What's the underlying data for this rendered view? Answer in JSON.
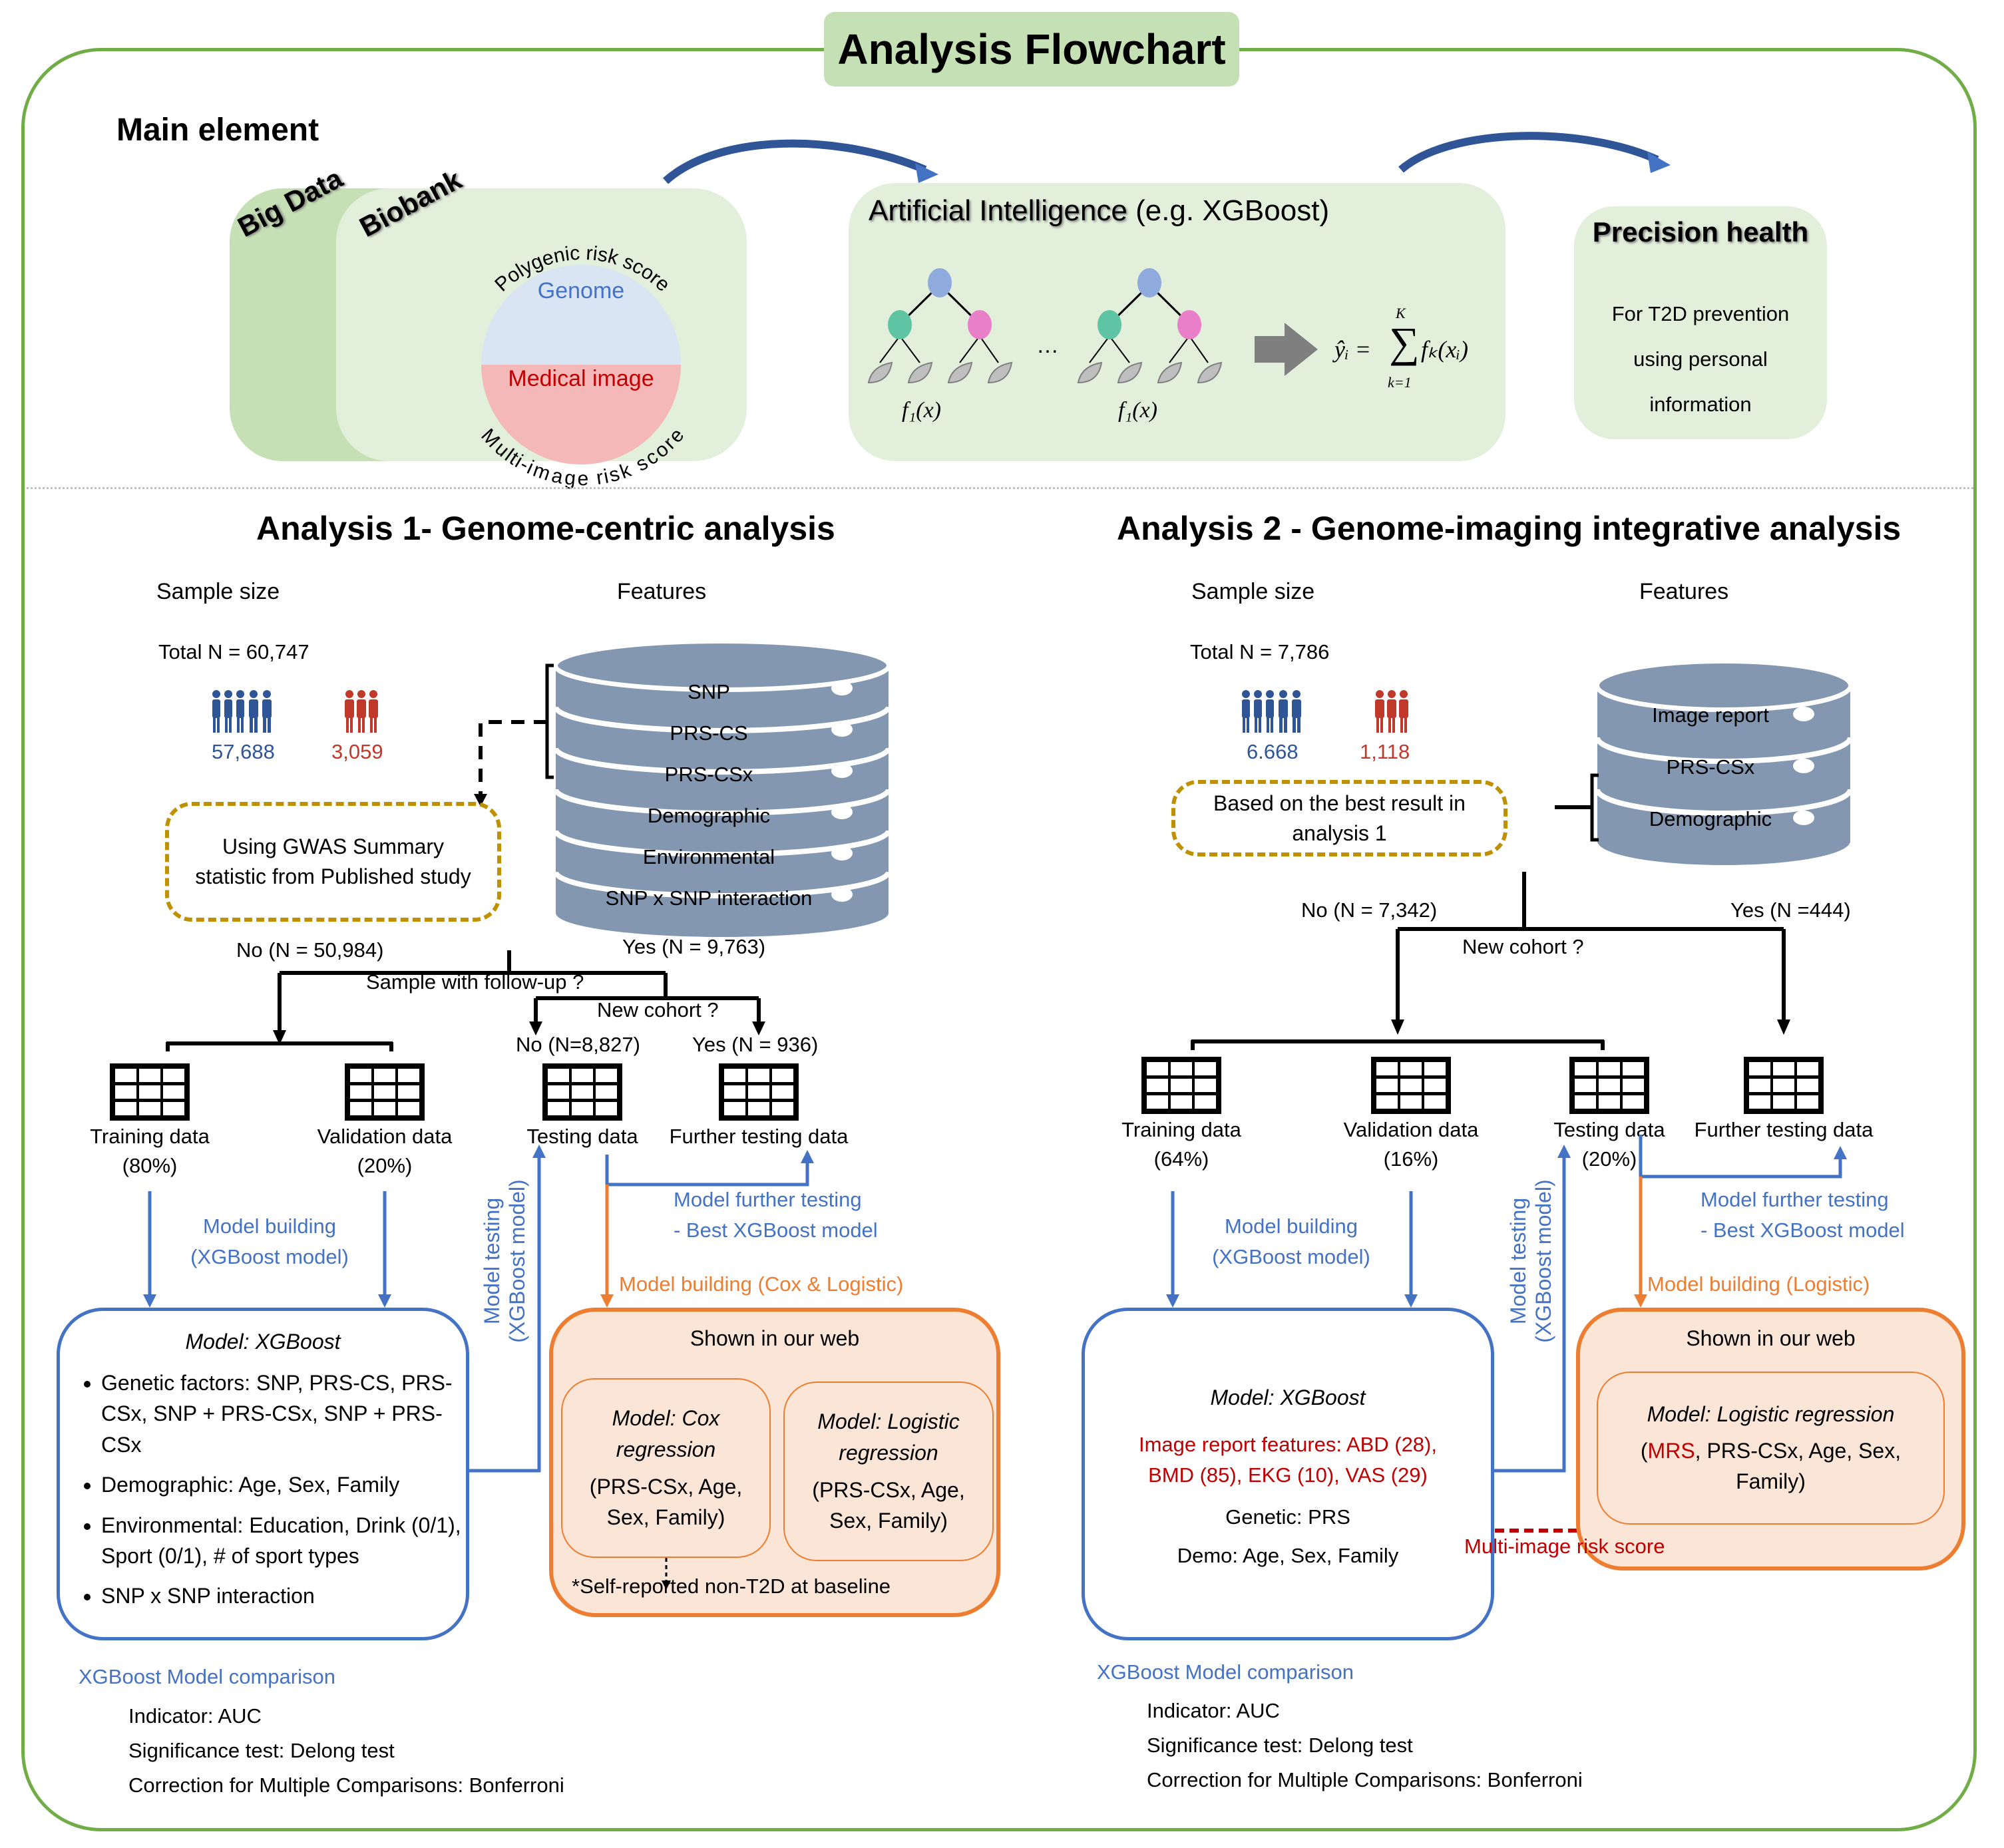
{
  "title": "Analysis Flowchart",
  "main_element": {
    "heading": "Main element",
    "big_data_label": "Big Data",
    "biobank_label": "Biobank",
    "circle": {
      "top_arc_label": "Polygenic risk score",
      "top_label": "Genome",
      "bottom_label": "Medical image",
      "bottom_arc_label": "Multi-image risk score"
    },
    "ai": {
      "title_main": "Artificial Intelligence",
      "title_suffix": " (e.g. XGBoost)",
      "tree1_label": "f₁(x)",
      "ellipsis": "…",
      "tree2_label": "f₁(x)",
      "formula_lhs": "ŷᵢ =",
      "formula_sigma": "∑",
      "formula_upper": "K",
      "formula_lower": "k=1",
      "formula_rhs": "fₖ(xᵢ)"
    },
    "precision_health": {
      "title": "Precision health",
      "lines": [
        "For T2D prevention",
        "using personal",
        "information"
      ]
    }
  },
  "analysis1": {
    "heading": "Analysis 1- Genome-centric analysis",
    "sample_size_label": "Sample size",
    "features_label": "Features",
    "total": "Total N = 60,747",
    "controls_count": "57,688",
    "cases_count": "3,059",
    "features": [
      "SNP",
      "PRS-CS",
      "PRS-CSx",
      "Demographic",
      "Environmental",
      "SNP x SNP interaction"
    ],
    "gwas_note": "Using GWAS Summary statistic from Published study",
    "split": {
      "no_label": "No (N = 50,984)",
      "yes_label": "Yes (N = 9,763)",
      "question": "Sample with follow-up ?",
      "sub_question": "New cohort ?",
      "sub_no_label": "No (N=8,827)",
      "sub_yes_label": "Yes (N = 936)"
    },
    "datasets": [
      {
        "name": "Training data",
        "pct": "(80%)"
      },
      {
        "name": "Validation data",
        "pct": "(20%)"
      },
      {
        "name": "Testing data",
        "pct": ""
      },
      {
        "name": "Further testing data",
        "pct": ""
      }
    ],
    "model_building_label": [
      "Model building",
      "(XGBoost model)"
    ],
    "model_testing_label": [
      "Model testing",
      "(XGBoost model)"
    ],
    "further_testing_label": [
      "Model further testing",
      "- Best XGBoost model"
    ],
    "orange_label": "Model building (Cox & Logistic)",
    "xgb_box": {
      "title": "Model: XGBoost",
      "bullets": [
        "Genetic factors: SNP, PRS-CS, PRS-CSx, SNP + PRS-CSx, SNP + PRS-CSx",
        "Demographic: Age, Sex, Family",
        "Environmental: Education, Drink (0/1), Sport (0/1), # of sport types",
        "SNP x SNP interaction"
      ]
    },
    "web_box": {
      "title": "Shown in our web",
      "cox_title": "Model: Cox regression",
      "cox_vars": "(PRS-CSx, Age, Sex, Family)",
      "logit_title": "Model: Logistic regression",
      "logit_vars": "(PRS-CSx, Age, Sex, Family)",
      "footnote": "*Self-reported non-T2D at baseline"
    },
    "comparison": {
      "title": "XGBoost Model comparison",
      "lines": [
        "Indicator: AUC",
        "Significance test: Delong test",
        "Correction for Multiple Comparisons: Bonferroni"
      ]
    }
  },
  "analysis2": {
    "heading": "Analysis 2 - Genome-imaging integrative analysis",
    "sample_size_label": "Sample size",
    "features_label": "Features",
    "total": "Total N = 7,786",
    "controls_count": "6.668",
    "cases_count": "1,118",
    "features": [
      "Image report",
      "PRS-CSx",
      "Demographic"
    ],
    "best_note": "Based on the best result in analysis 1",
    "split": {
      "no_label": "No (N = 7,342)",
      "yes_label": "Yes (N =444)",
      "question": "New cohort ?"
    },
    "datasets": [
      {
        "name": "Training data",
        "pct": "(64%)"
      },
      {
        "name": "Validation data",
        "pct": "(16%)"
      },
      {
        "name": "Testing data",
        "pct": "(20%)"
      },
      {
        "name": "Further testing data",
        "pct": ""
      }
    ],
    "model_building_label": [
      "Model building",
      "(XGBoost model)"
    ],
    "model_testing_label": [
      "Model testing",
      "(XGBoost model)"
    ],
    "further_testing_label": [
      "Model further testing",
      "- Best XGBoost model"
    ],
    "orange_label": "Model building (Logistic)",
    "xgb_box": {
      "title": "Model: XGBoost",
      "image_features": [
        "Image report features: ABD (28),",
        "BMD (85), EKG (10), VAS (29)"
      ],
      "genetic": "Genetic: PRS",
      "demo": "Demo: Age, Sex, Family"
    },
    "mrs_label": "Multi-image risk score",
    "web_box": {
      "title": "Shown in our web",
      "logit_title": "Model: Logistic regression",
      "logit_open": "(",
      "logit_mrs": "MRS",
      "logit_rest": ", PRS-CSx, Age, Sex, Family)"
    },
    "comparison": {
      "title": "XGBoost Model comparison",
      "lines": [
        "Indicator: AUC",
        "Significance test: Delong test",
        "Correction for Multiple Comparisons: Bonferroni"
      ]
    }
  },
  "colors": {
    "frame_green": "#70ad47",
    "panel_green": "#e2efda",
    "title_green": "#c5e0b4",
    "flow_blue": "#4472c4",
    "flow_orange": "#ed7d31",
    "mrs_red": "#c00000",
    "dashed_gold": "#bf9000",
    "db_slate": "#8497b0",
    "controls_blue": "#2f5597",
    "cases_red": "#c0392b"
  }
}
